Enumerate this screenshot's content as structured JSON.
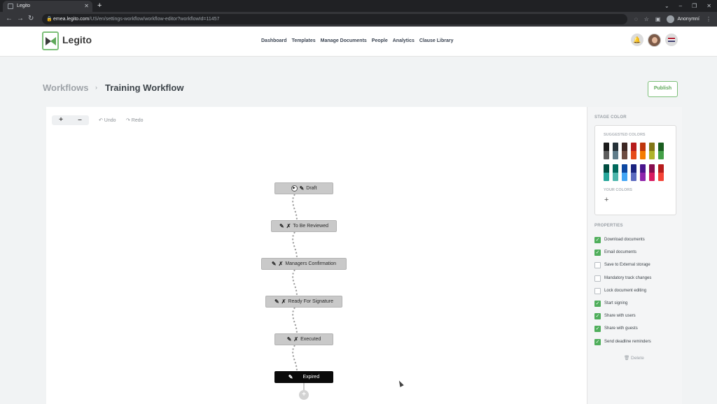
{
  "browser": {
    "tab_title": "Legito",
    "tab_close": "✕",
    "new_tab": "+",
    "url_domain": "emea.legito.com",
    "url_path": "/US/en/settings-workflow/workflow-editor?workflowId=11457",
    "profile_label": "Anonymní",
    "window_controls": [
      "⌄",
      "–",
      "❐",
      "✕"
    ]
  },
  "header": {
    "logo_text": "Legito",
    "nav": [
      "Dashboard",
      "Templates",
      "Manage Documents",
      "People",
      "Analytics",
      "Clause Library"
    ]
  },
  "breadcrumb": {
    "root": "Workflows",
    "separator": "›",
    "current": "Training Workflow"
  },
  "publish_label": "Publish",
  "toolbar": {
    "zoom_in": "+",
    "zoom_out": "–",
    "undo": "↶ Undo",
    "redo": "↷ Redo"
  },
  "stages": [
    {
      "label": "Draft",
      "kind": "start"
    },
    {
      "label": "To Be Reviewed",
      "kind": "normal"
    },
    {
      "label": "Managers Confirmation",
      "kind": "normal"
    },
    {
      "label": "Ready For Signature",
      "kind": "normal"
    },
    {
      "label": "Executed",
      "kind": "normal"
    },
    {
      "label": "Expired",
      "kind": "selected"
    }
  ],
  "add_stage": "+",
  "sidebar": {
    "stage_color_heading": "STAGE COLOR",
    "suggested_colors_heading": "SUGGESTED COLORS",
    "suggested_row1": [
      [
        "#1b1b1b",
        "#5c5c5c"
      ],
      [
        "#263238",
        "#607d8b"
      ],
      [
        "#3e2723",
        "#6d4c41"
      ],
      [
        "#b71c1c",
        "#e64a19"
      ],
      [
        "#bf360c",
        "#f57c00"
      ],
      [
        "#827717",
        "#afb42b"
      ],
      [
        "#1b5e20",
        "#43a047"
      ]
    ],
    "suggested_row2": [
      [
        "#004d40",
        "#26a69a"
      ],
      [
        "#00695c",
        "#4db6ac"
      ],
      [
        "#0d47a1",
        "#42a5f5"
      ],
      [
        "#1a237e",
        "#5c6bc0"
      ],
      [
        "#4a148c",
        "#8e24aa"
      ],
      [
        "#880e4f",
        "#d81b60"
      ],
      [
        "#b71c1c",
        "#f44336"
      ]
    ],
    "your_colors_heading": "YOUR COLORS",
    "add_color": "+",
    "properties_heading": "PROPERTIES",
    "properties": [
      {
        "label": "Download documents",
        "checked": true
      },
      {
        "label": "Email documents",
        "checked": true
      },
      {
        "label": "Save to External storage",
        "checked": false
      },
      {
        "label": "Mandatory track changes",
        "checked": false
      },
      {
        "label": "Lock document editing",
        "checked": false
      },
      {
        "label": "Start signing",
        "checked": true
      },
      {
        "label": "Share with users",
        "checked": true
      },
      {
        "label": "Share with guests",
        "checked": true
      },
      {
        "label": "Send deadline reminders",
        "checked": true
      }
    ],
    "delete_label": "🗑 Delete"
  }
}
